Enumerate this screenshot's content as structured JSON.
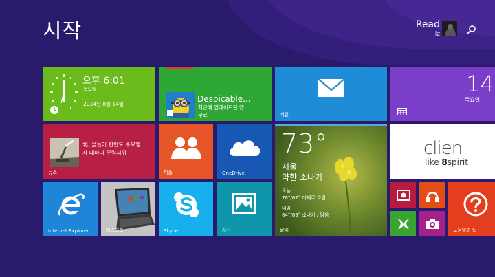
{
  "header": {
    "title": "시작",
    "user_name": "Read",
    "user_sub": "iz"
  },
  "tiles": {
    "clock": {
      "time": "오후 6:01",
      "day": "목요일",
      "date": "2014년 8월 14일"
    },
    "despicable": {
      "title": "Despicable...",
      "subtitle_line1": "최근에 업데이트된 앱",
      "subtitle_line2": "무료"
    },
    "mail": {
      "label": "메일"
    },
    "calendar": {
      "date_number": "14",
      "day": "목요일"
    },
    "news": {
      "headline_line1": "北, 올들어 한반도 주요행",
      "headline_line2": "사 때마다 무력시위",
      "label": "뉴스"
    },
    "people": {
      "label": "피플"
    },
    "onedrive": {
      "label": "OneDrive"
    },
    "weather": {
      "temperature": "73°",
      "city": "서울",
      "condition": "약한 소나기",
      "today_label": "오늘",
      "today_forecast": "78°/67° 대체로 흐림",
      "tomorrow_label": "내일",
      "tomorrow_forecast": "84°/69° 소나기 / 맑음",
      "label": "날씨"
    },
    "clien": {
      "logo_text": "clien",
      "tagline_prefix": "like ",
      "tagline_number": "8",
      "tagline_suffix": "spirit"
    },
    "ie": {
      "label": "Internet Explorer"
    },
    "desktop": {
      "label": "데스크톱"
    },
    "skype": {
      "label": "Skype"
    },
    "photos": {
      "label": "사진"
    },
    "help": {
      "label": "도움말과 팁"
    }
  },
  "colors": {
    "background": "#2a1a6b",
    "clock": "#6cbb1d",
    "store": "#2ea735",
    "mail": "#1e8cd6",
    "calendar": "#7b3ec9",
    "news": "#b81f44",
    "people": "#e65527",
    "onedrive": "#1758b5",
    "ie": "#1e85d8",
    "skype": "#18b0ec",
    "photos": "#0f96ad",
    "help": "#e33e1e",
    "video": "#b81b3f",
    "music": "#e64e17",
    "games": "#3aa433",
    "camera": "#a5208a"
  }
}
